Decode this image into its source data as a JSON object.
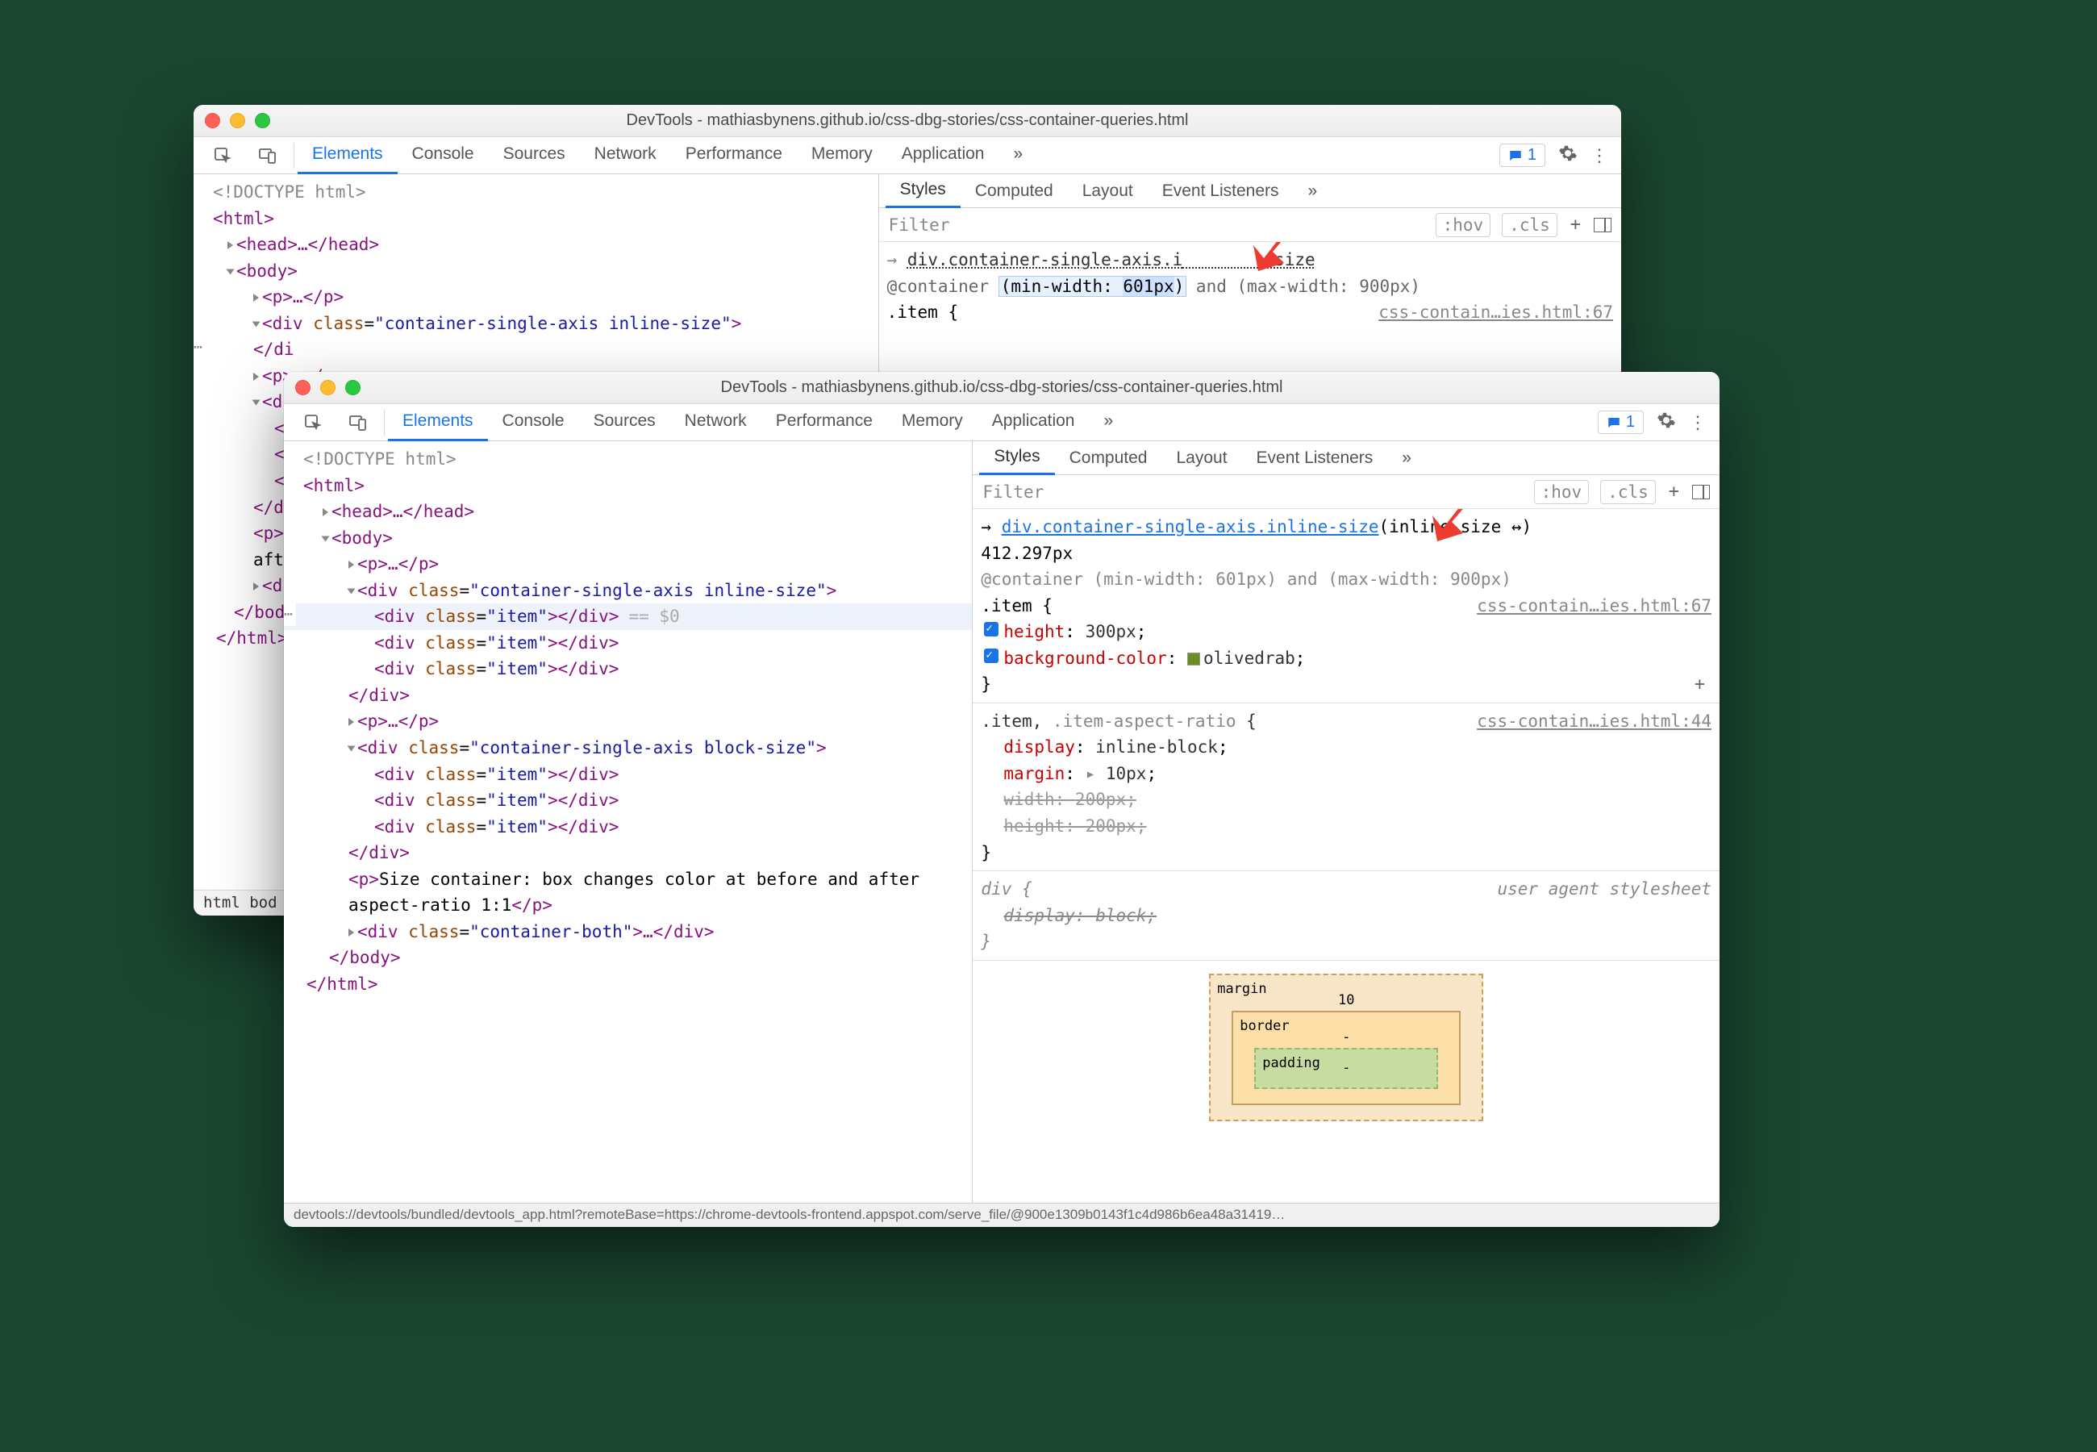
{
  "window_a": {
    "title": "DevTools - mathiasbynens.github.io/css-dbg-stories/css-container-queries.html",
    "tabs": [
      "Elements",
      "Console",
      "Sources",
      "Network",
      "Performance",
      "Memory",
      "Application"
    ],
    "active_tab": "Elements",
    "more_tabs_glyph": "»",
    "badge_count": "1",
    "subtabs": [
      "Styles",
      "Computed",
      "Layout",
      "Event Listeners"
    ],
    "active_subtab": "Styles",
    "filter_placeholder": "Filter",
    "hov_label": ":hov",
    "cls_label": ".cls",
    "dom": {
      "doctype": "<!DOCTYPE html>",
      "html_open": "<html>",
      "head": "<head>…</head>",
      "body_open": "<body>",
      "p1": "<p>…</p>",
      "div_open_prefix": "<div ",
      "class_attr": "class",
      "container_class": "\"container-single-axis inline-size\"",
      "tag_close": ">",
      "p2": "<p>…</p>",
      "div_close": "</div>",
      "container2_class": "\"container-single-axis block-size\"",
      "p3_text": "Size container: box changes color at before and after aspect-ratio 1:1",
      "short_prefix": "<p>S",
      "after_word": "afte",
      "d_open": "<d",
      "d_close": "</di",
      "body_close": "</body",
      "html_close": "</html>",
      "breadcrumb": "html  bod"
    },
    "styles": {
      "target_selector_prefix": "div.container-single-axis.i",
      "target_selector_suffix": "-size",
      "container_rule_a": "@container ",
      "container_rule_b": "(min-width: ",
      "container_rule_val": "601px",
      "container_rule_c": ") and (max-width: 900px)",
      "item_sel": ".item {",
      "source_link": "css-contain…ies.html:67"
    }
  },
  "window_b": {
    "title": "DevTools - mathiasbynens.github.io/css-dbg-stories/css-container-queries.html",
    "tabs": [
      "Elements",
      "Console",
      "Sources",
      "Network",
      "Performance",
      "Memory",
      "Application"
    ],
    "active_tab": "Elements",
    "more_tabs_glyph": "»",
    "badge_count": "1",
    "subtabs": [
      "Styles",
      "Computed",
      "Layout",
      "Event Listeners"
    ],
    "active_subtab": "Styles",
    "filter_placeholder": "Filter",
    "hov_label": ":hov",
    "cls_label": ".cls",
    "dom": {
      "doctype": "<!DOCTYPE html>",
      "html_open": "<html>",
      "head": "<head>…</head>",
      "body_open": "<body>",
      "p_empty": "<p>…</p>",
      "div1_class": "\"container-single-axis inline-size\"",
      "item_class": "\"item\"",
      "eq0": "== $0",
      "div2_class": "\"container-single-axis block-size\"",
      "para_text": "Size container: box changes color at before and after aspect-ratio 1:1",
      "div3_class": "\"container-both\""
    },
    "styles": {
      "target_link": "div.container-single-axis.inline-size",
      "target_dim_label": "(inline-size ↔)",
      "target_dim_val": "412.297px",
      "container_rule": "@container (min-width: 601px) and (max-width: 900px)",
      "item_sel": ".item {",
      "source_link_67": "css-contain…ies.html:67",
      "prop_height": "height",
      "prop_height_val": "300px",
      "prop_bg": "background-color",
      "prop_bg_val": "olivedrab",
      "close_brace": "}",
      "rule2_sel": ".item, .item-aspect-ratio {",
      "source_link_44": "css-contain…ies.html:44",
      "prop_display": "display",
      "prop_display_val": "inline-block",
      "prop_margin": "margin",
      "prop_margin_val": "10px",
      "prop_width": "width",
      "prop_width_val": "200px",
      "prop_height2": "height",
      "prop_height2_val": "200px",
      "rule3_sel": "div {",
      "ua_label": "user agent stylesheet",
      "prop_display2": "display",
      "prop_display2_val": "block",
      "box_model": {
        "margin_label": "margin",
        "margin_top": "10",
        "border_label": "border",
        "border_top": "-",
        "padding_label": "padding",
        "padding_top": "-"
      }
    },
    "status_bar": "devtools://devtools/bundled/devtools_app.html?remoteBase=https://chrome-devtools-frontend.appspot.com/serve_file/@900e1309b0143f1c4d986b6ea48a31419…"
  }
}
